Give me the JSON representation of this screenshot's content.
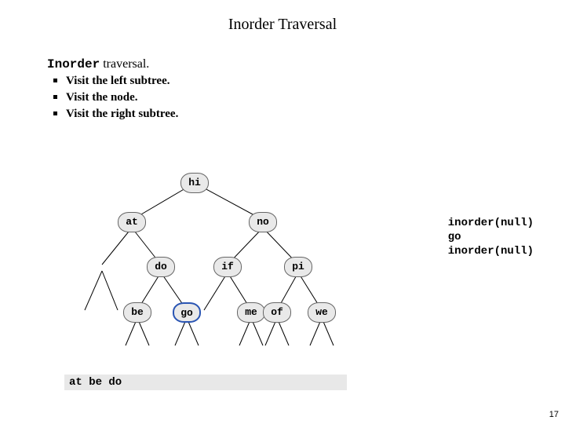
{
  "title": "Inorder Traversal",
  "heading": {
    "prefix": "Inorder",
    "suffix": " traversal."
  },
  "bullets": {
    "b1": "Visit the left subtree.",
    "b2": "Visit the node.",
    "b3": "Visit the right subtree."
  },
  "tree": {
    "hi": "hi",
    "at": "at",
    "no": "no",
    "do": "do",
    "if": "if",
    "pi": "pi",
    "be": "be",
    "go": "go",
    "me": "me",
    "of": "of",
    "we": "we"
  },
  "trace": {
    "l1": "inorder(null)",
    "l2": "go",
    "l3": "inorder(null)"
  },
  "result": "at be do",
  "page_number": "17",
  "accent_color": "#2a55b3"
}
